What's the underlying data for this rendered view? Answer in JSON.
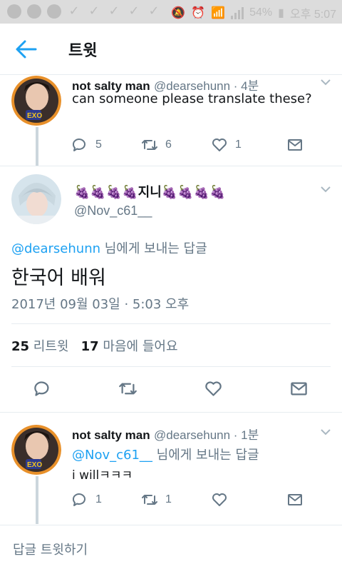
{
  "status_bar": {
    "battery": "54%",
    "time": "오후 5:07"
  },
  "header": {
    "title": "트윗"
  },
  "parent_tweet": {
    "name": "not salty man",
    "handle": "@dearsehunn",
    "time": " · 4분",
    "text": "can someone please translate these?",
    "replies": "5",
    "retweets": "6",
    "likes": "1"
  },
  "main_tweet": {
    "display_name": "🍇🍇🍇🍇지니🍇🍇🍇🍇",
    "handle": "@Nov_c61__",
    "reply_to_handle": "@dearsehunn",
    "reply_to_suffix": " 님에게 보내는 답글",
    "text": "한국어 배워",
    "timestamp": "2017년 09월 03일 · 5:03 오후",
    "retweet_count": "25",
    "retweet_label": " 리트윗",
    "like_count": "17",
    "like_label": " 마음에 들어요"
  },
  "reply_tweet": {
    "name": "not salty man",
    "handle": "@dearsehunn",
    "time": " · 1분",
    "reply_to_handle": "@Nov_c61__",
    "reply_to_suffix": " 님에게 보내는 답글",
    "text": "i willㅋㅋㅋ",
    "replies": "1",
    "retweets": "1"
  },
  "footer": {
    "reply_placeholder": "답글 트윗하기"
  },
  "colors": {
    "accent": "#1da1f2",
    "secondary_text": "#657786",
    "divider": "#e6ecf0"
  }
}
